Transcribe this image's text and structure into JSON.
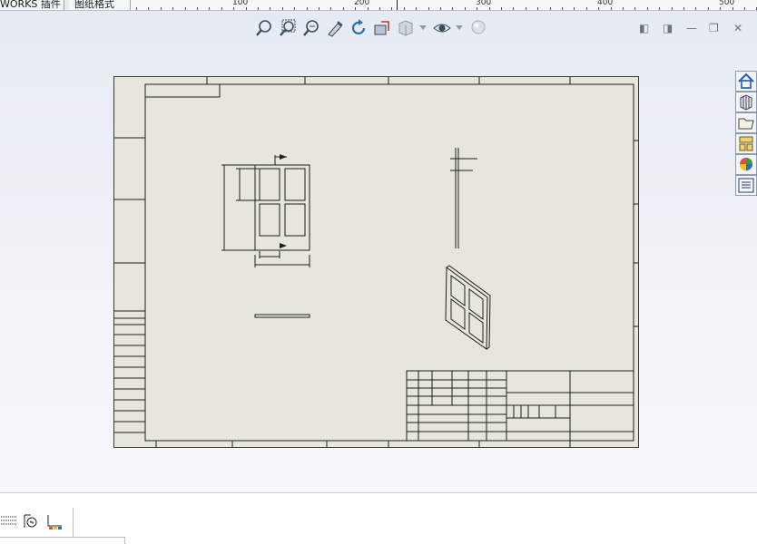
{
  "tabs": [
    {
      "label": "WORKS 插件"
    },
    {
      "label": "图纸格式"
    }
  ],
  "ruler": {
    "labels": [
      "100",
      "200",
      "300",
      "400",
      "500"
    ]
  },
  "toolbar": {
    "icons": [
      "zoom-to-fit-icon",
      "zoom-to-area-icon",
      "zoom-in-out-icon",
      "select-icon",
      "rotate-icon",
      "previous-view-icon",
      "display-style-icon",
      "hide-show-icon",
      "appearance-icon"
    ]
  },
  "window_controls": {
    "prev": "◧",
    "next": "◨",
    "minimize": "—",
    "restore": "❐",
    "close": "✕"
  },
  "taskpane": {
    "icons": [
      "home-icon",
      "design-library-icon",
      "file-explorer-icon",
      "view-palette-icon",
      "appearances-icon",
      "custom-properties-icon"
    ]
  },
  "bottom": {
    "icons": [
      "grid-icon",
      "sheet-format-icon",
      "layer-icon"
    ]
  },
  "colors": {
    "canvas_top": "#e6ebf3",
    "sheet": "#e7e6dc",
    "line": "#1e1e1e",
    "accent": "#2a6fb5"
  }
}
